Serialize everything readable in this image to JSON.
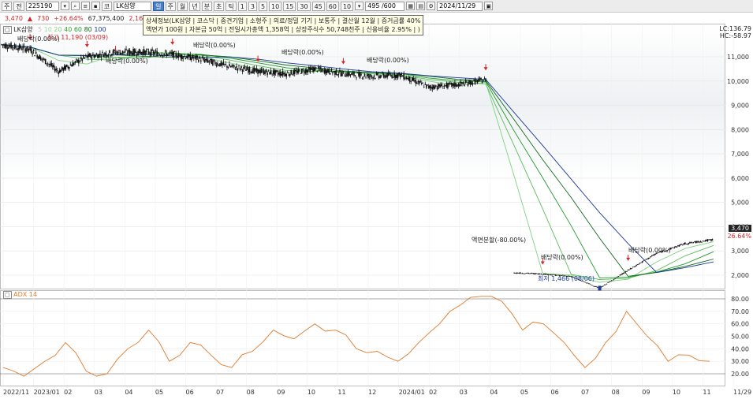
{
  "toolbar": {
    "market_label": "주",
    "type_label": "전",
    "code_value": "225190",
    "name_prefix": "코",
    "name_value": "LK삼양",
    "period_buttons": [
      "일",
      "주",
      "월",
      "년",
      "분",
      "초",
      "틱"
    ],
    "interval_buttons": [
      "1",
      "3",
      "5",
      "10",
      "15",
      "30",
      "45",
      "60",
      "10"
    ],
    "count_value": "495 /600",
    "date_value": "2024/11/29"
  },
  "quote": {
    "price": "3,470",
    "change": "730",
    "change_pct": "+26.64%",
    "volume": "67,375,400",
    "extra": "2,164"
  },
  "tooltip": {
    "line1": "상세정보(LK삼양 | 코스닥 | 중견기업 | 소형주 | 의료/정밀 기기 | 보통주 | 결산월 12월 | 증거금률 40%",
    "line2": "액면가 100원 | 자본금 50억 | 전일시가총액 1,358억 | 상장주식수 50,748천주 | 신용비율 2.95% | )"
  },
  "price_panel": {
    "legend_name": "LK삼양",
    "ma_legend": [
      "5",
      "10",
      "20",
      "40",
      "60",
      "80",
      "100"
    ],
    "hi_label": "최고 11,190 (03/09)",
    "lo_label": "최저 1,466 (08/06)",
    "events": [
      {
        "text": "배당락(0.00%)",
        "kind": "dividend"
      },
      {
        "text": "배당락(0.00%)",
        "kind": "dividend"
      },
      {
        "text": "배당락(0.00%)",
        "kind": "dividend"
      },
      {
        "text": "배당락(0.00%)",
        "kind": "dividend"
      },
      {
        "text": "배당락(0.00%)",
        "kind": "dividend"
      },
      {
        "text": "액면분할(-80.00%)",
        "kind": "split"
      },
      {
        "text": "배당락(0.00%)",
        "kind": "dividend"
      },
      {
        "text": "배당락(0.00%)",
        "kind": "dividend"
      }
    ],
    "y_ticks": [
      "11,000",
      "10,000",
      "9,000",
      "8,000",
      "7,000",
      "6,000",
      "5,000",
      "4,000",
      "3,000",
      "2,000"
    ],
    "right_top": [
      "LC:136.79",
      "HC:-58.97"
    ],
    "current_price_tag": "3,470",
    "current_pct_tag": "26.64%"
  },
  "adx_panel": {
    "legend": "ADX 14",
    "y_ticks": [
      "80.00",
      "70.00",
      "60.00",
      "50.00",
      "40.00",
      "30.00",
      "20.00"
    ]
  },
  "x_axis": [
    "2022/11",
    "2023/01",
    "02",
    "03",
    "04",
    "05",
    "06",
    "07",
    "08",
    "09",
    "10",
    "11",
    "12",
    "2024/01",
    "02",
    "03",
    "04",
    "05",
    "06",
    "07",
    "08",
    "09",
    "10",
    "11",
    "11/29"
  ],
  "colors": {
    "candle": "#111111",
    "up": "#d4262b",
    "ma_green": "#1f9a2a",
    "ma_light": "#7fd27f",
    "ma_blue": "#1a3a9a",
    "adx_line": "#e07a2a"
  },
  "chart_data": {
    "type": "line",
    "title": "LK삼양",
    "x_range": [
      "2022/11",
      "2024/11/29"
    ],
    "price_series_approx": [
      {
        "date": "2022/11",
        "close": 11500
      },
      {
        "date": "2022/12",
        "close": 11300
      },
      {
        "date": "2023/01",
        "close": 10400
      },
      {
        "date": "2023/02",
        "close": 11000
      },
      {
        "date": "2023/03",
        "close": 11190
      },
      {
        "date": "2023/04",
        "close": 11200
      },
      {
        "date": "2023/05",
        "close": 11100
      },
      {
        "date": "2023/06",
        "close": 10900
      },
      {
        "date": "2023/07",
        "close": 10600
      },
      {
        "date": "2023/08",
        "close": 10400
      },
      {
        "date": "2023/09",
        "close": 10300
      },
      {
        "date": "2023/10",
        "close": 10500
      },
      {
        "date": "2023/11",
        "close": 10300
      },
      {
        "date": "2023/12",
        "close": 10200
      },
      {
        "date": "2024/01",
        "close": 10250
      },
      {
        "date": "2024/02",
        "close": 9750
      },
      {
        "date": "2024/03",
        "close": 9850
      },
      {
        "date": "2024/04",
        "close": 10050
      },
      {
        "date": "2024/05",
        "close": 2100
      },
      {
        "date": "2024/06",
        "close": 2050
      },
      {
        "date": "2024/07",
        "close": 1950
      },
      {
        "date": "2024/08",
        "close": 1466
      },
      {
        "date": "2024/09",
        "close": 2200
      },
      {
        "date": "2024/10",
        "close": 2900
      },
      {
        "date": "2024/11",
        "close": 3300
      },
      {
        "date": "2024/11/29",
        "close": 3470
      }
    ],
    "adx_series_approx": [
      25,
      18,
      30,
      45,
      22,
      20,
      40,
      55,
      30,
      45,
      35,
      25,
      38,
      55,
      48,
      60,
      55,
      40,
      38,
      30,
      45,
      60,
      75,
      82,
      78,
      55,
      60,
      45,
      25,
      45,
      70,
      50,
      30,
      35,
      30
    ]
  }
}
